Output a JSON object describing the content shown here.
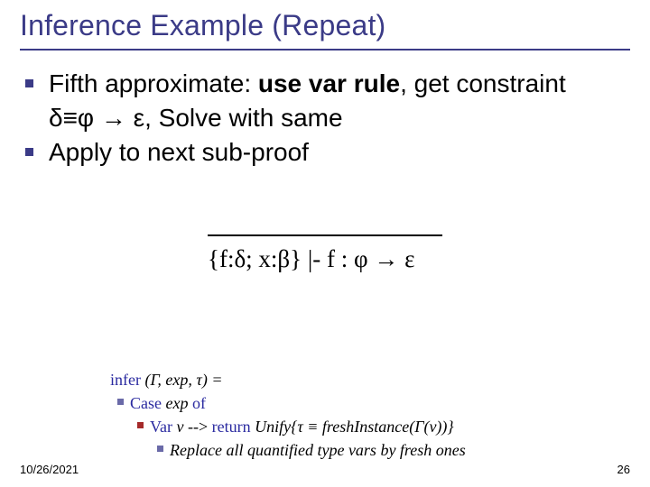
{
  "title": "Inference Example (Repeat)",
  "bullets": [
    {
      "pre": "Fifth approximate: ",
      "strong": "use var rule",
      "post": ", get constraint δ≡φ → ε, Solve with same"
    },
    {
      "pre": "Apply to next sub-proof",
      "strong": "",
      "post": ""
    }
  ],
  "proof": "{f:δ; x:β} |- f : φ → ε",
  "legend": {
    "line1_label": "infer",
    "line1_rest": " (Γ, exp, τ) =",
    "line2_label": "Case ",
    "line2_rest": "exp",
    "line2_tail": " of",
    "line3_head": "Var ",
    "line3_var": "ν",
    "line3_arrow": " --> ",
    "line3_ret": "return",
    "line3_rest": " Unify{τ ≡ freshInstance(Γ(ν))}",
    "line4": "Replace all quantified type vars by fresh ones"
  },
  "footer": {
    "date": "10/26/2021",
    "page": "26"
  }
}
